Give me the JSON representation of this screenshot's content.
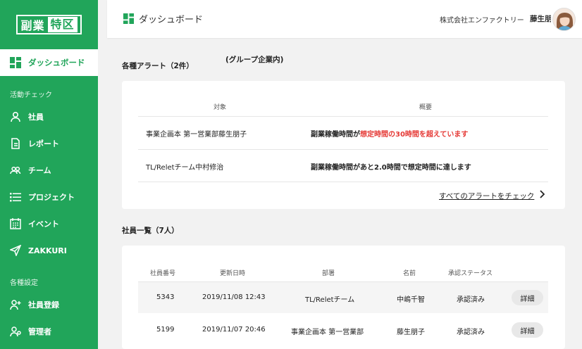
{
  "brand": {
    "part1": "副業",
    "part2": "特区"
  },
  "sidebar": {
    "active": {
      "label": "ダッシュボード"
    },
    "section1": "活動チェック",
    "items1": [
      {
        "label": "社員"
      },
      {
        "label": "レポート"
      },
      {
        "label": "チーム"
      },
      {
        "label": "プロジェクト"
      },
      {
        "label": "イベント"
      },
      {
        "label": "ZAKKURI"
      }
    ],
    "section2": "各種設定",
    "items2": [
      {
        "label": "社員登録"
      },
      {
        "label": "管理者"
      }
    ]
  },
  "header": {
    "title": "ダッシュボード",
    "company": "株式会社エンファクトリー",
    "user": "藤生朋子"
  },
  "alerts": {
    "heading": "各種アラート（2件）",
    "note": "(グループ企業内)",
    "col_target": "対象",
    "col_summary": "概要",
    "rows": [
      {
        "target": "事業企画本 第一営業部藤生朋子",
        "summary_prefix": "副業稼働時間が",
        "summary_highlight": "想定時間の30時間を超えています"
      },
      {
        "target": "TL/Reletチーム中村修治",
        "summary_prefix": "",
        "summary_highlight": "副業稼働時間があと2.0時間で想定時間に達します"
      }
    ],
    "check_all": "すべてのアラートをチェック"
  },
  "employees": {
    "heading": "社員一覧（7人）",
    "headers": [
      "社員番号",
      "更新日時",
      "部署",
      "名前",
      "承認ステータス"
    ],
    "rows": [
      {
        "id": "5343",
        "updated": "2019/11/08 12:43",
        "dept": "TL/Reletチーム",
        "name": "中嶋千智",
        "status": "承認済み",
        "action": "詳細"
      },
      {
        "id": "5199",
        "updated": "2019/11/07 20:46",
        "dept": "事業企画本 第一営業部",
        "name": "藤生朋子",
        "status": "承認済み",
        "action": "詳細"
      }
    ]
  },
  "colors": {
    "brand": "#21a55a",
    "alert": "#e53935"
  }
}
